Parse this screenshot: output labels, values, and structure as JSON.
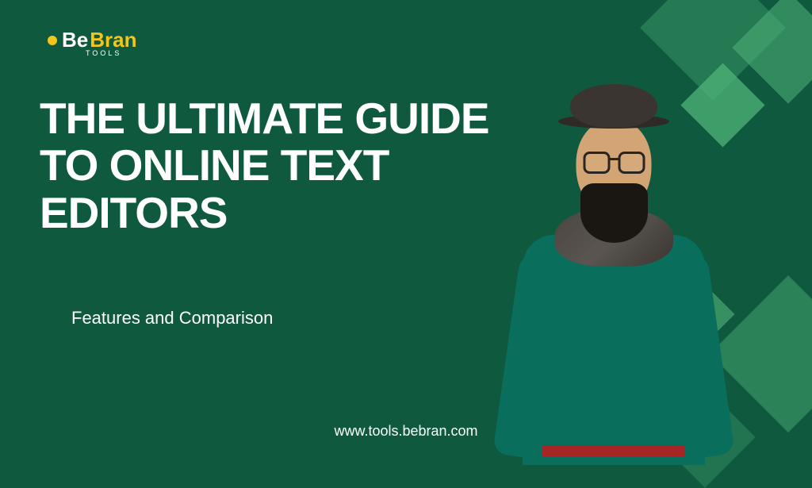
{
  "logo": {
    "be": "Be",
    "bran": "Bran",
    "tools": "TOOLS"
  },
  "headline": "THE ULTIMATE GUIDE TO ONLINE TEXT EDITORS",
  "subtitle": "Features and Comparison",
  "url": "www.tools.bebran.com"
}
